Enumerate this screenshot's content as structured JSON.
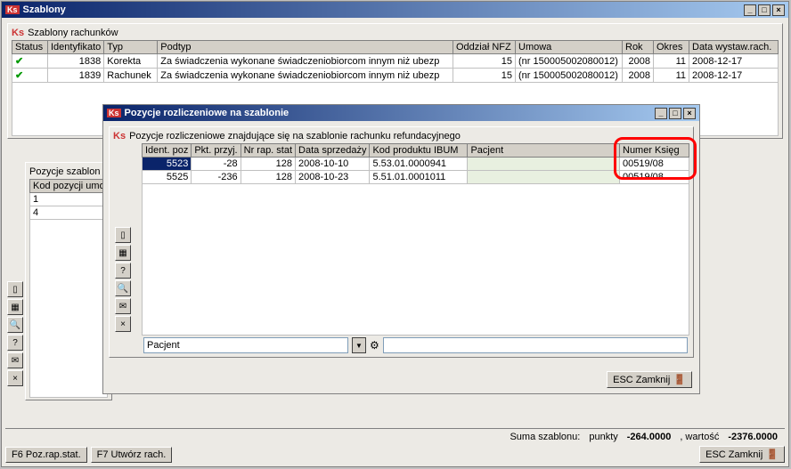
{
  "main_window": {
    "title": "Szablony",
    "group_title": "Szablony rachunków",
    "cols": [
      "Status",
      "Identyfikato",
      "Typ",
      "Podtyp",
      "Oddział NFZ",
      "Umowa",
      "Rok",
      "Okres",
      "Data wystaw.rach."
    ],
    "rows": [
      {
        "status": "✔",
        "id": "1838",
        "typ": "Korekta",
        "podtyp": "Za świadczenia wykonane świadczeniobiorcom innym niż ubezp",
        "oddzial": "15",
        "umowa": "(nr 150005002080012)",
        "rok": "2008",
        "okres": "11",
        "data": "2008-12-17"
      },
      {
        "status": "✔",
        "id": "1839",
        "typ": "Rachunek",
        "podtyp": "Za świadczenia wykonane świadczeniobiorcom innym niż ubezp",
        "oddzial": "15",
        "umowa": "(nr 150005002080012)",
        "rok": "2008",
        "okres": "11",
        "data": "2008-12-17"
      }
    ],
    "left_panel": {
      "title": "Pozycje szablon",
      "col": "Kod pozycji umo",
      "rows": [
        "1",
        "4"
      ]
    },
    "summary": {
      "label": "Suma szablonu:",
      "unit": "punkty",
      "val1": "-264.0000",
      "sep": ", wartość",
      "val2": "-2376.0000"
    },
    "footer": {
      "f6": "F6 Poz.rap.stat.",
      "f7": "F7 Utwórz rach.",
      "esc": "ESC Zamknij"
    }
  },
  "dialog": {
    "title": "Pozycje rozliczeniowe na szablonie",
    "subtitle": "Pozycje rozliczeniowe znajdujące się na szablonie rachunku refundacyjnego",
    "cols": [
      "Ident. poz",
      "Pkt. przyj.",
      "Nr rap. stat",
      "Data sprzedaży",
      "Kod produktu IBUM",
      "Pacjent",
      "Numer Księg"
    ],
    "rows": [
      {
        "id": "5523",
        "pkt": "-28",
        "nr": "128",
        "data": "2008-10-10",
        "kod": "5.53.01.0000941",
        "pacjent": "",
        "ksieg": "00519/08"
      },
      {
        "id": "5525",
        "pkt": "-236",
        "nr": "128",
        "data": "2008-10-23",
        "kod": "5.51.01.0001011",
        "pacjent": "",
        "ksieg": "00519/08"
      }
    ],
    "filter": "Pacjent",
    "esc": "ESC Zamknij"
  }
}
